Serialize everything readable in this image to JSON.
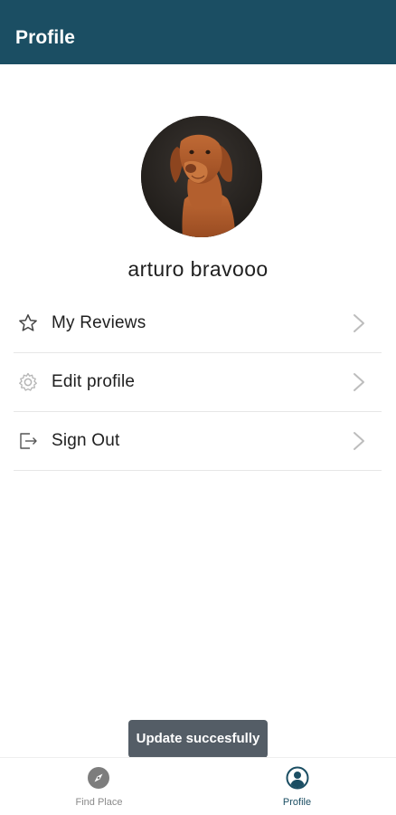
{
  "app_bar": {
    "title": "Profile"
  },
  "profile": {
    "name": "arturo bravooo"
  },
  "menu": {
    "items": [
      {
        "label": "My Reviews",
        "icon": "star-icon"
      },
      {
        "label": "Edit profile",
        "icon": "gear-icon"
      },
      {
        "label": "Sign Out",
        "icon": "sign-out-icon"
      }
    ]
  },
  "toast": {
    "message": "Update succesfully"
  },
  "bottom_nav": {
    "items": [
      {
        "label": "Find Place",
        "icon": "compass-icon",
        "active": false
      },
      {
        "label": "Profile",
        "icon": "account-circle-icon",
        "active": true
      }
    ]
  },
  "colors": {
    "app_bar": "#1b4e63",
    "toast_bg": "#545d66",
    "active_nav": "#1b4e63",
    "inactive_nav": "#8a8a8a"
  }
}
